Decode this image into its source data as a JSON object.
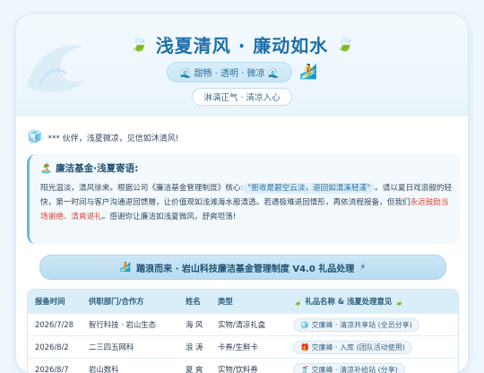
{
  "hero": {
    "leaf_left": "🍃",
    "title": "浅夏清风 · 廉动如水",
    "leaf_right": "🍃",
    "tagline": "🌊 甜畅 · 透明 · 微凉 🌊",
    "surfer": "🏄",
    "slogan": "淋漓正气 · 清凉入心"
  },
  "greeting": {
    "icon": "🧊",
    "text": "*** 伙伴，浅夏微凉，见信如沐清风!"
  },
  "message": {
    "title_icon": "🏝️",
    "title": "廉洁基金·浅夏寄语:",
    "p1": "阳光温淡，清风徐来。根据公司《廉洁基金管理制度》核心:",
    "quote": "\"拒收是碧空云淡，退回如清溪轻漾\"",
    "p2": "。请以夏日戏浪般的轻快，第一时间与客户沟通退回馈赠，让价值观如浅滩海水般清透。若遇极难退回情形，再依流程报备，但我们",
    "highlight": "永远鼓励当场谢绝、清爽退礼",
    "p3": "。感谢你让廉洁如浅夏微风，舒爽坦荡!"
  },
  "banner": {
    "icon": "🏄",
    "text": "踏浪而来 · 岩山科技廉洁基金管理制度 V4.0 礼品处理",
    "tail_icon": "⚡"
  },
  "table": {
    "headers": [
      "报备时间",
      "供职部门/合作方",
      "姓名",
      "类型",
      "🍃 礼品名称 & 浅夏处理意见 🍃"
    ],
    "rows": [
      {
        "date": "2026/7/28",
        "dept": "智行科技 · 岩山生态",
        "name": "海 风",
        "type": "实物/清凉礼盒",
        "gift_icon": "🧊",
        "gift": "交廉峰 · 清凉共享站 (全员分享)"
      },
      {
        "date": "2026/8/2",
        "dept": "二三四五网科",
        "name": "浪 涛",
        "type": "卡券/生鲜卡",
        "gift_icon": "🎁",
        "gift": "交廉峰 · 入库 (团队活动使用)"
      },
      {
        "date": "2026/8/7",
        "dept": "岩山数科",
        "name": "夏 爽",
        "type": "实物/饮料券",
        "gift_icon": "🥤",
        "gift": "交廉峰 · 清凉补给站 (分享)"
      }
    ]
  }
}
